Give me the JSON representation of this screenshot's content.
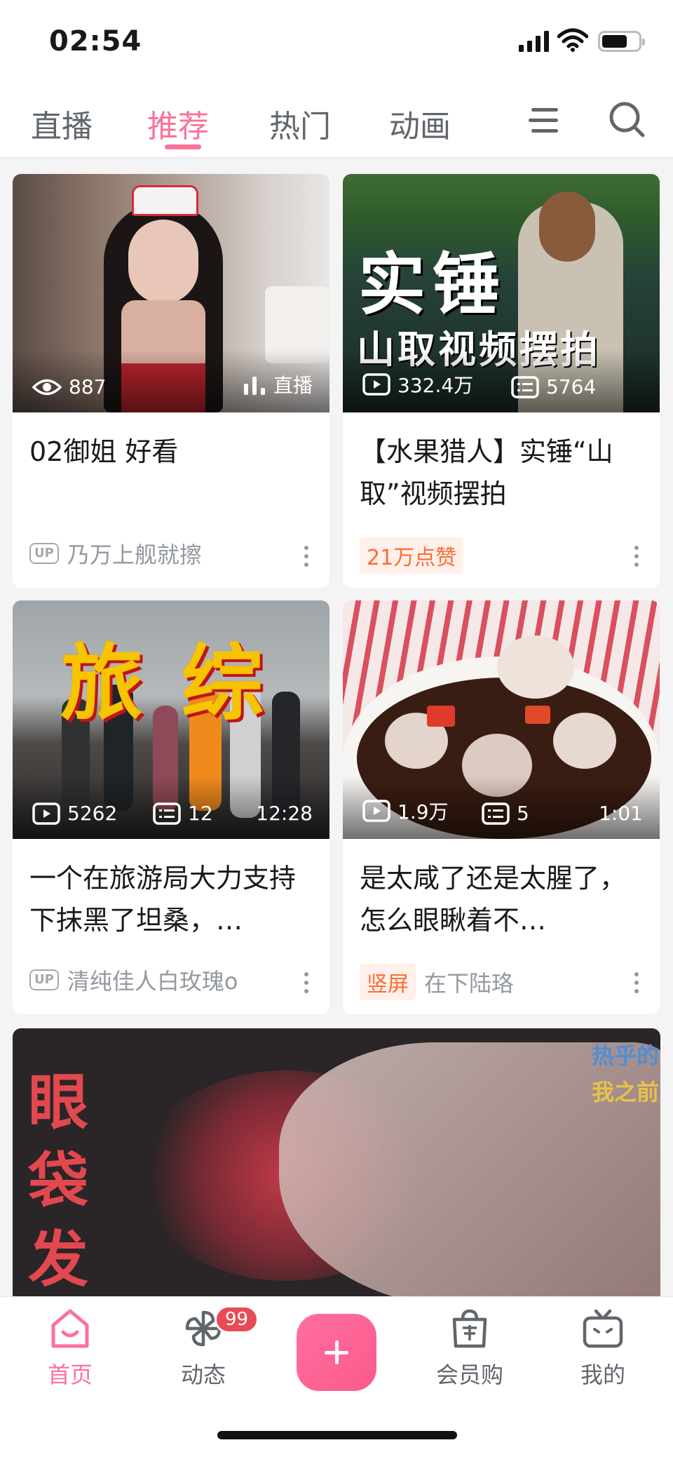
{
  "status_bar": {
    "time": "02:54"
  },
  "top_nav": {
    "tabs": [
      "直播",
      "推荐",
      "热门",
      "动画"
    ],
    "active_tab": "推荐"
  },
  "feed": [
    {
      "stat1": "887",
      "stat2": "直播",
      "title": "02御姐   好看",
      "up_badge": "UP",
      "author": "乃万上舰就擦"
    },
    {
      "overlay_big": "实锤",
      "overlay_small": "山取视频摆拍",
      "views": "332.4万",
      "comments": "5764",
      "title": "【水果猎人】实锤“山取”视频摆拍",
      "tag": "21万点赞"
    },
    {
      "overlay": "旅综",
      "views": "5262",
      "comments": "12",
      "duration": "12:28",
      "title": "一个在旅游局大力支持下抹黑了坦桑，…",
      "up_badge": "UP",
      "author": "清纯佳人白玫瑰o"
    },
    {
      "views": "1.9万",
      "comments": "5",
      "duration": "1:01",
      "title": "是太咸了还是太腥了，怎么眼瞅着不…",
      "tag": "竖屏",
      "author": "在下陆珞"
    }
  ],
  "big_card": {
    "overlay_text": "眼袋发",
    "corner_line1": "热乎的",
    "corner_line2": "我之前"
  },
  "bottom_nav": {
    "home": "首页",
    "dynamic": "动态",
    "dynamic_badge": "99",
    "vip_shop": "会员购",
    "mine": "我的"
  },
  "colors": {
    "accent": "#fb7299",
    "tag_orange": "#ff6b35",
    "badge_red": "#e84b55"
  }
}
